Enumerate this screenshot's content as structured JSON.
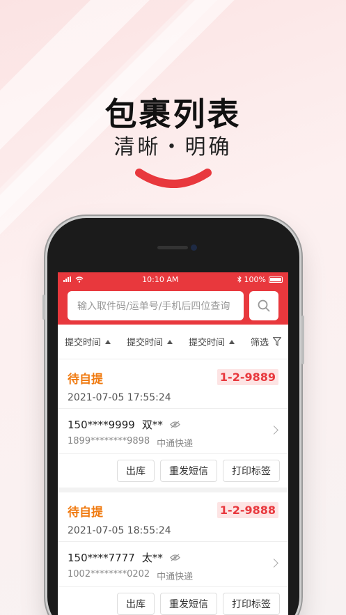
{
  "hero": {
    "title": "包裹列表",
    "subtitle": "清晰・明确"
  },
  "status_bar": {
    "time": "10:10 AM",
    "battery": "100%"
  },
  "search": {
    "placeholder": "输入取件码/运单号/手机后四位查询"
  },
  "filters": {
    "sort1": "提交时间",
    "sort2": "提交时间",
    "sort3": "提交时间",
    "filter": "筛选"
  },
  "parcels": [
    {
      "status": "待自提",
      "time": "2021-07-05 17:55:24",
      "code": "1-2-9889",
      "phone": "150****9999",
      "name": "双**",
      "waybill": "1899********9898",
      "courier": "中通快递",
      "actions": [
        "出库",
        "重发短信",
        "打印标签"
      ]
    },
    {
      "status": "待自提",
      "time": "2021-07-05 18:55:24",
      "code": "1-2-9888",
      "phone": "150****7777",
      "name": "太**",
      "waybill": "1002********0202",
      "courier": "中通快递",
      "actions": [
        "出库",
        "重发短信",
        "打印标签"
      ]
    }
  ],
  "colors": {
    "brand_red": "#e8383d",
    "status_orange": "#f07a10",
    "badge_bg": "#fde4e4"
  }
}
